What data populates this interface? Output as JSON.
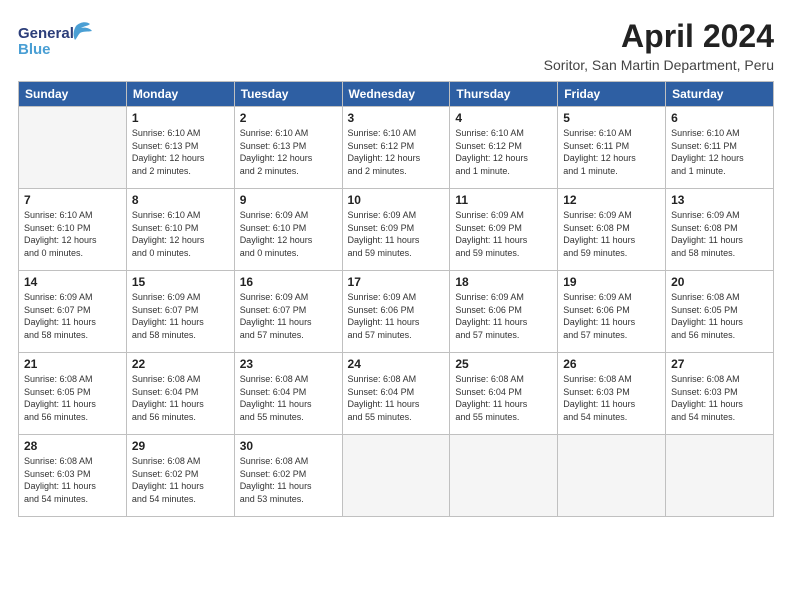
{
  "header": {
    "logo_general": "General",
    "logo_blue": "Blue",
    "title": "April 2024",
    "subtitle": "Soritor, San Martin Department, Peru"
  },
  "days_of_week": [
    "Sunday",
    "Monday",
    "Tuesday",
    "Wednesday",
    "Thursday",
    "Friday",
    "Saturday"
  ],
  "weeks": [
    [
      {
        "day": "",
        "info": ""
      },
      {
        "day": "1",
        "info": "Sunrise: 6:10 AM\nSunset: 6:13 PM\nDaylight: 12 hours\nand 2 minutes."
      },
      {
        "day": "2",
        "info": "Sunrise: 6:10 AM\nSunset: 6:13 PM\nDaylight: 12 hours\nand 2 minutes."
      },
      {
        "day": "3",
        "info": "Sunrise: 6:10 AM\nSunset: 6:12 PM\nDaylight: 12 hours\nand 2 minutes."
      },
      {
        "day": "4",
        "info": "Sunrise: 6:10 AM\nSunset: 6:12 PM\nDaylight: 12 hours\nand 1 minute."
      },
      {
        "day": "5",
        "info": "Sunrise: 6:10 AM\nSunset: 6:11 PM\nDaylight: 12 hours\nand 1 minute."
      },
      {
        "day": "6",
        "info": "Sunrise: 6:10 AM\nSunset: 6:11 PM\nDaylight: 12 hours\nand 1 minute."
      }
    ],
    [
      {
        "day": "7",
        "info": "Sunrise: 6:10 AM\nSunset: 6:10 PM\nDaylight: 12 hours\nand 0 minutes."
      },
      {
        "day": "8",
        "info": "Sunrise: 6:10 AM\nSunset: 6:10 PM\nDaylight: 12 hours\nand 0 minutes."
      },
      {
        "day": "9",
        "info": "Sunrise: 6:09 AM\nSunset: 6:10 PM\nDaylight: 12 hours\nand 0 minutes."
      },
      {
        "day": "10",
        "info": "Sunrise: 6:09 AM\nSunset: 6:09 PM\nDaylight: 11 hours\nand 59 minutes."
      },
      {
        "day": "11",
        "info": "Sunrise: 6:09 AM\nSunset: 6:09 PM\nDaylight: 11 hours\nand 59 minutes."
      },
      {
        "day": "12",
        "info": "Sunrise: 6:09 AM\nSunset: 6:08 PM\nDaylight: 11 hours\nand 59 minutes."
      },
      {
        "day": "13",
        "info": "Sunrise: 6:09 AM\nSunset: 6:08 PM\nDaylight: 11 hours\nand 58 minutes."
      }
    ],
    [
      {
        "day": "14",
        "info": "Sunrise: 6:09 AM\nSunset: 6:07 PM\nDaylight: 11 hours\nand 58 minutes."
      },
      {
        "day": "15",
        "info": "Sunrise: 6:09 AM\nSunset: 6:07 PM\nDaylight: 11 hours\nand 58 minutes."
      },
      {
        "day": "16",
        "info": "Sunrise: 6:09 AM\nSunset: 6:07 PM\nDaylight: 11 hours\nand 57 minutes."
      },
      {
        "day": "17",
        "info": "Sunrise: 6:09 AM\nSunset: 6:06 PM\nDaylight: 11 hours\nand 57 minutes."
      },
      {
        "day": "18",
        "info": "Sunrise: 6:09 AM\nSunset: 6:06 PM\nDaylight: 11 hours\nand 57 minutes."
      },
      {
        "day": "19",
        "info": "Sunrise: 6:09 AM\nSunset: 6:06 PM\nDaylight: 11 hours\nand 57 minutes."
      },
      {
        "day": "20",
        "info": "Sunrise: 6:08 AM\nSunset: 6:05 PM\nDaylight: 11 hours\nand 56 minutes."
      }
    ],
    [
      {
        "day": "21",
        "info": "Sunrise: 6:08 AM\nSunset: 6:05 PM\nDaylight: 11 hours\nand 56 minutes."
      },
      {
        "day": "22",
        "info": "Sunrise: 6:08 AM\nSunset: 6:04 PM\nDaylight: 11 hours\nand 56 minutes."
      },
      {
        "day": "23",
        "info": "Sunrise: 6:08 AM\nSunset: 6:04 PM\nDaylight: 11 hours\nand 55 minutes."
      },
      {
        "day": "24",
        "info": "Sunrise: 6:08 AM\nSunset: 6:04 PM\nDaylight: 11 hours\nand 55 minutes."
      },
      {
        "day": "25",
        "info": "Sunrise: 6:08 AM\nSunset: 6:04 PM\nDaylight: 11 hours\nand 55 minutes."
      },
      {
        "day": "26",
        "info": "Sunrise: 6:08 AM\nSunset: 6:03 PM\nDaylight: 11 hours\nand 54 minutes."
      },
      {
        "day": "27",
        "info": "Sunrise: 6:08 AM\nSunset: 6:03 PM\nDaylight: 11 hours\nand 54 minutes."
      }
    ],
    [
      {
        "day": "28",
        "info": "Sunrise: 6:08 AM\nSunset: 6:03 PM\nDaylight: 11 hours\nand 54 minutes."
      },
      {
        "day": "29",
        "info": "Sunrise: 6:08 AM\nSunset: 6:02 PM\nDaylight: 11 hours\nand 54 minutes."
      },
      {
        "day": "30",
        "info": "Sunrise: 6:08 AM\nSunset: 6:02 PM\nDaylight: 11 hours\nand 53 minutes."
      },
      {
        "day": "",
        "info": ""
      },
      {
        "day": "",
        "info": ""
      },
      {
        "day": "",
        "info": ""
      },
      {
        "day": "",
        "info": ""
      }
    ]
  ]
}
